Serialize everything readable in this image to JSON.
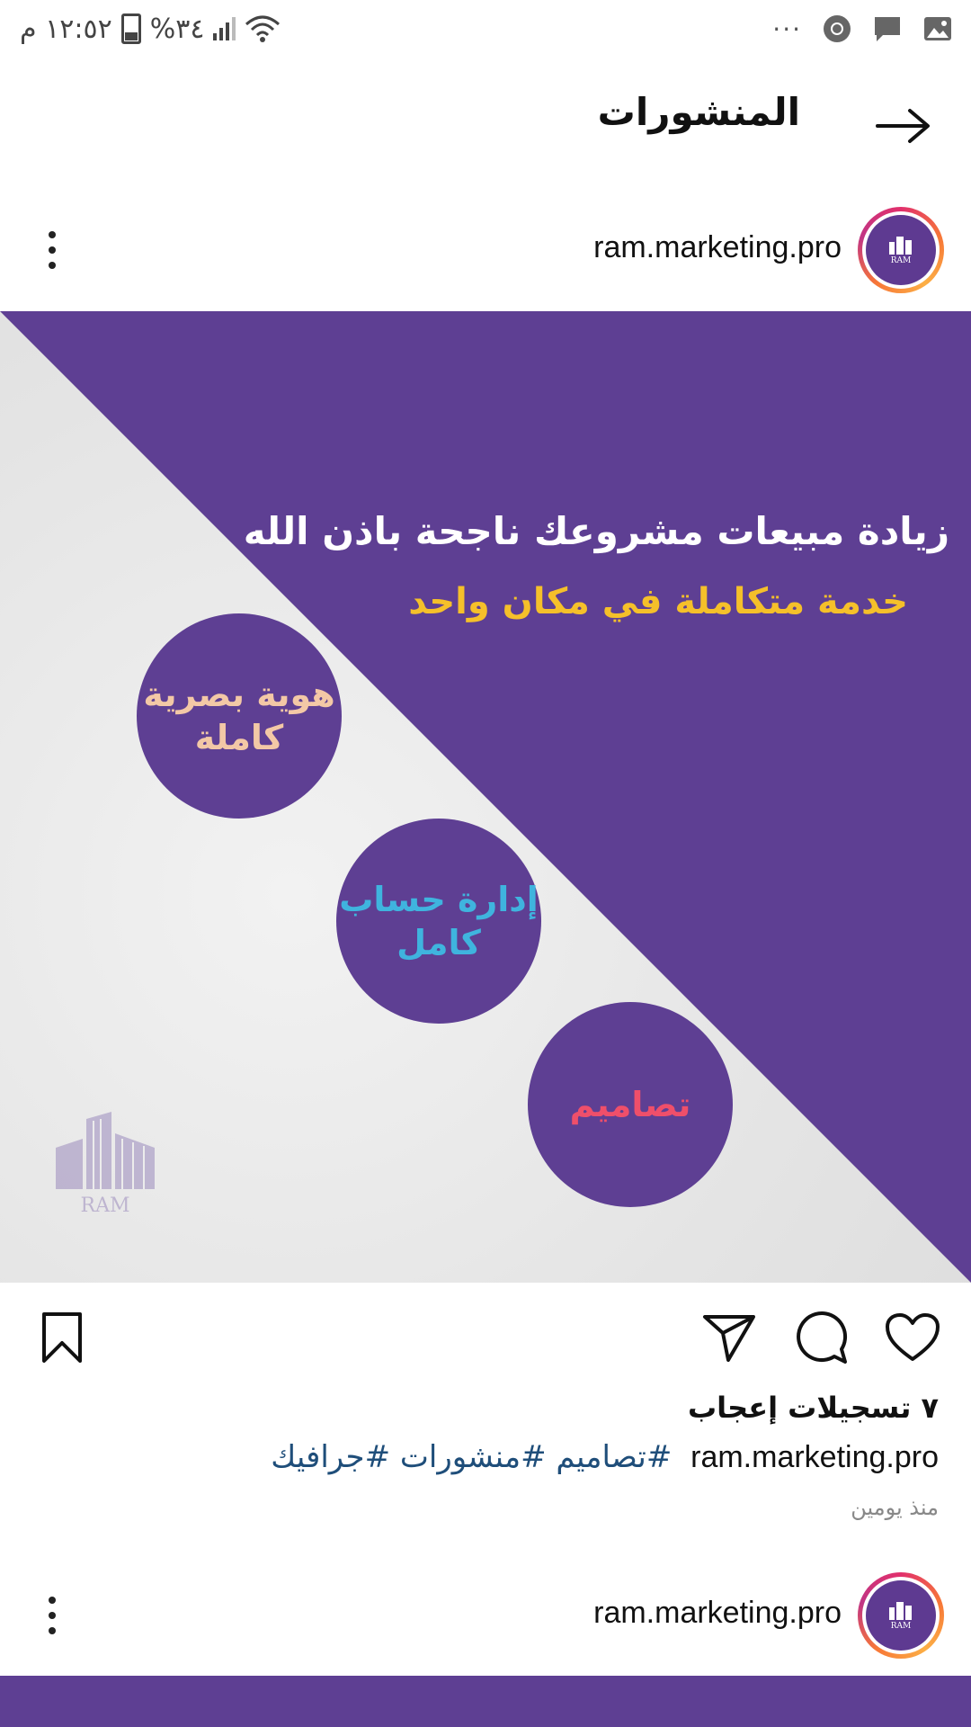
{
  "status_bar": {
    "time": "١٢:٥٢ م",
    "battery": "%٣٤",
    "overflow": "···"
  },
  "header": {
    "title": "المنشورات",
    "back_icon": "arrow-right-icon"
  },
  "post": {
    "username": "ram.marketing.pro",
    "avatar_text": "RAM",
    "image": {
      "headline": "زيادة مبيعات مشروعك ناجحة باذن الله",
      "subline": "خدمة متكاملة في مكان واحد",
      "circle_1": [
        "هوية بصرية",
        "كاملة"
      ],
      "circle_2": [
        "إدارة حساب",
        "كامل"
      ],
      "circle_3": "تصاميم",
      "watermark_name": "RAM",
      "colors": {
        "purple": "#5e3f93",
        "gold": "#f5c02a",
        "peach": "#f3c8a6",
        "cyan": "#3fb4de",
        "red": "#ef4f6a"
      }
    },
    "likes": "٧ تسجيلات إعجاب",
    "caption_user": "ram.marketing.pro",
    "caption_tags": "#تصاميم #منشورات #جرافيك",
    "timestamp": "منذ يومين"
  },
  "post2": {
    "username": "ram.marketing.pro",
    "avatar_text": "RAM"
  }
}
